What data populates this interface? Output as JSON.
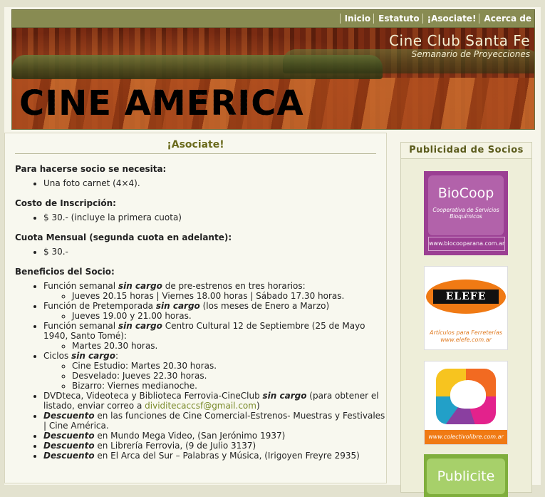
{
  "nav": {
    "items": [
      "Inicio",
      "Estatuto",
      "¡Asociate!",
      "Acerca de"
    ]
  },
  "banner": {
    "title": "Cine Club Santa Fe",
    "subtitle": "Semanario de Proyecciones",
    "logo_text": "CINE AMERICA"
  },
  "main": {
    "heading": "¡Asociate!",
    "req_title": "Para hacerse socio se necesita:",
    "req_item": "Una foto carnet (4×4).",
    "cost_title": "Costo de Inscripción:",
    "cost_item": "$ 30.-  (incluye la primera cuota)",
    "monthly_title": "Cuota Mensual (segunda cuota en adelante):",
    "monthly_item": "$ 30.-",
    "benefits_title": "Beneficios del Socio:",
    "b1_pre": "Función semanal ",
    "b1_em": "sin cargo",
    "b1_post": " de pre-estrenos en tres horarios:",
    "b1_sub": "Jueves 20.15 horas | Viernes 18.00 horas | Sábado 17.30 horas.",
    "b2_pre": "Función de Pretemporada ",
    "b2_em": "sin cargo",
    "b2_post": " (los meses de Enero a Marzo)",
    "b2_sub": "Jueves 19.00 y 21.00 horas.",
    "b3_pre": "Función semanal ",
    "b3_em": "sin cargo",
    "b3_post": " Centro Cultural 12 de Septiembre (25 de Mayo 1940, Santo Tomé):",
    "b3_sub": "Martes 20.30 horas.",
    "b4_pre": "Ciclos ",
    "b4_em": "sin cargo",
    "b4_post": ":",
    "b4_subs": [
      "Cine Estudio: Martes 20.30 horas.",
      "Desvelado: Jueves 22.30 horas.",
      "Bizarro: Viernes medianoche."
    ],
    "b5_pre": "DVDteca, Videoteca y Biblioteca Ferrovia-CineClub ",
    "b5_em": "sin cargo",
    "b5_post": " (para obtener el listado, enviar correo a ",
    "b5_mail": "dividitecaccsf@gmail.com",
    "b5_end": ")",
    "b6_em": "Descuento",
    "b6_post": " en las funciones de Cine Comercial-Estrenos- Muestras y Festivales | Cine América.",
    "b7_em": "Descuento",
    "b7_post": " en Mundo Mega Video, (San Jerónimo  1937)",
    "b8_em": "Descuento",
    "b8_post": " en Librería Ferrovia, (9 de Julio 3137)",
    "b9_em": "Descuento",
    "b9_post": " en El Arca del Sur – Palabras y Música, (Irigoyen Freyre 2935)"
  },
  "sidebar": {
    "heading": "Publicidad de Socios",
    "ads": [
      {
        "name": "BioCoop",
        "desc": "Cooperativa de Servicios Bioquímicos",
        "url": "www.biocooparana.com.ar"
      },
      {
        "name": "ELEFE",
        "desc": "Artículos para Ferreterías www.elefe.com.ar"
      },
      {
        "name": "colectivolibre",
        "url": "www.colectivolibre.com.ar"
      },
      {
        "name": "Publicite"
      }
    ]
  }
}
